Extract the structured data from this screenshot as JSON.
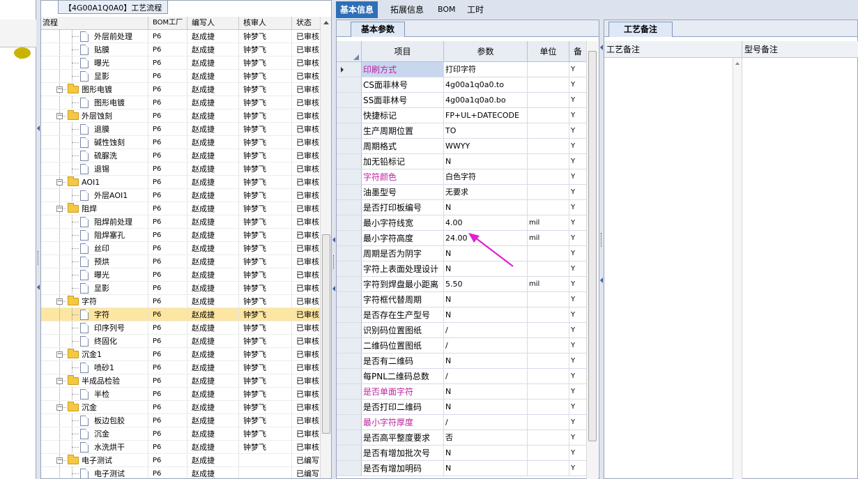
{
  "tree": {
    "title": "【4G00A1Q0A0】工艺流程",
    "columns": [
      "流程",
      "BOM工厂",
      "编写人",
      "核审人",
      "状态"
    ],
    "rows": [
      {
        "level": 2,
        "type": "doc",
        "name": "外层前处理",
        "bom": "P6",
        "writer": "赵成捷",
        "reviewer": "钟梦飞",
        "status": "已审核"
      },
      {
        "level": 2,
        "type": "doc",
        "name": "贴膜",
        "bom": "P6",
        "writer": "赵成捷",
        "reviewer": "钟梦飞",
        "status": "已审核"
      },
      {
        "level": 2,
        "type": "doc",
        "name": "曝光",
        "bom": "P6",
        "writer": "赵成捷",
        "reviewer": "钟梦飞",
        "status": "已审核"
      },
      {
        "level": 2,
        "type": "doc",
        "name": "显影",
        "bom": "P6",
        "writer": "赵成捷",
        "reviewer": "钟梦飞",
        "status": "已审核"
      },
      {
        "level": 1,
        "type": "folder",
        "name": "图形电镀",
        "bom": "P6",
        "writer": "赵成捷",
        "reviewer": "钟梦飞",
        "status": "已审核"
      },
      {
        "level": 2,
        "type": "doc",
        "name": "图形电镀",
        "bom": "P6",
        "writer": "赵成捷",
        "reviewer": "钟梦飞",
        "status": "已审核"
      },
      {
        "level": 1,
        "type": "folder",
        "name": "外层蚀刻",
        "bom": "P6",
        "writer": "赵成捷",
        "reviewer": "钟梦飞",
        "status": "已审核"
      },
      {
        "level": 2,
        "type": "doc",
        "name": "退膜",
        "bom": "P6",
        "writer": "赵成捷",
        "reviewer": "钟梦飞",
        "status": "已审核"
      },
      {
        "level": 2,
        "type": "doc",
        "name": "碱性蚀刻",
        "bom": "P6",
        "writer": "赵成捷",
        "reviewer": "钟梦飞",
        "status": "已审核"
      },
      {
        "level": 2,
        "type": "doc",
        "name": "硫脲洗",
        "bom": "P6",
        "writer": "赵成捷",
        "reviewer": "钟梦飞",
        "status": "已审核"
      },
      {
        "level": 2,
        "type": "doc",
        "name": "退锡",
        "bom": "P6",
        "writer": "赵成捷",
        "reviewer": "钟梦飞",
        "status": "已审核"
      },
      {
        "level": 1,
        "type": "folder",
        "name": "AOI1",
        "bom": "P6",
        "writer": "赵成捷",
        "reviewer": "钟梦飞",
        "status": "已审核"
      },
      {
        "level": 2,
        "type": "doc",
        "name": "外层AOI1",
        "bom": "P6",
        "writer": "赵成捷",
        "reviewer": "钟梦飞",
        "status": "已审核"
      },
      {
        "level": 1,
        "type": "folder",
        "name": "阻焊",
        "bom": "P6",
        "writer": "赵成捷",
        "reviewer": "钟梦飞",
        "status": "已审核"
      },
      {
        "level": 2,
        "type": "doc",
        "name": "阻焊前处理",
        "bom": "P6",
        "writer": "赵成捷",
        "reviewer": "钟梦飞",
        "status": "已审核"
      },
      {
        "level": 2,
        "type": "doc",
        "name": "阻焊塞孔",
        "bom": "P6",
        "writer": "赵成捷",
        "reviewer": "钟梦飞",
        "status": "已审核"
      },
      {
        "level": 2,
        "type": "doc",
        "name": "丝印",
        "bom": "P6",
        "writer": "赵成捷",
        "reviewer": "钟梦飞",
        "status": "已审核"
      },
      {
        "level": 2,
        "type": "doc",
        "name": "预烘",
        "bom": "P6",
        "writer": "赵成捷",
        "reviewer": "钟梦飞",
        "status": "已审核"
      },
      {
        "level": 2,
        "type": "doc",
        "name": "曝光",
        "bom": "P6",
        "writer": "赵成捷",
        "reviewer": "钟梦飞",
        "status": "已审核"
      },
      {
        "level": 2,
        "type": "doc",
        "name": "显影",
        "bom": "P6",
        "writer": "赵成捷",
        "reviewer": "钟梦飞",
        "status": "已审核"
      },
      {
        "level": 1,
        "type": "folder",
        "name": "字符",
        "bom": "P6",
        "writer": "赵成捷",
        "reviewer": "钟梦飞",
        "status": "已审核"
      },
      {
        "level": 2,
        "type": "doc",
        "name": "字符",
        "bom": "P6",
        "writer": "赵成捷",
        "reviewer": "钟梦飞",
        "status": "已审核",
        "selected": true
      },
      {
        "level": 2,
        "type": "doc",
        "name": "印序列号",
        "bom": "P6",
        "writer": "赵成捷",
        "reviewer": "钟梦飞",
        "status": "已审核"
      },
      {
        "level": 2,
        "type": "doc",
        "name": "终固化",
        "bom": "P6",
        "writer": "赵成捷",
        "reviewer": "钟梦飞",
        "status": "已审核"
      },
      {
        "level": 1,
        "type": "folder",
        "name": "沉金1",
        "bom": "P6",
        "writer": "赵成捷",
        "reviewer": "钟梦飞",
        "status": "已审核"
      },
      {
        "level": 2,
        "type": "doc",
        "name": "喷砂1",
        "bom": "P6",
        "writer": "赵成捷",
        "reviewer": "钟梦飞",
        "status": "已审核"
      },
      {
        "level": 1,
        "type": "folder",
        "name": "半成品检验",
        "bom": "P6",
        "writer": "赵成捷",
        "reviewer": "钟梦飞",
        "status": "已审核"
      },
      {
        "level": 2,
        "type": "doc",
        "name": "半检",
        "bom": "P6",
        "writer": "赵成捷",
        "reviewer": "钟梦飞",
        "status": "已审核"
      },
      {
        "level": 1,
        "type": "folder",
        "name": "沉金",
        "bom": "P6",
        "writer": "赵成捷",
        "reviewer": "钟梦飞",
        "status": "已审核"
      },
      {
        "level": 2,
        "type": "doc",
        "name": "板边包胶",
        "bom": "P6",
        "writer": "赵成捷",
        "reviewer": "钟梦飞",
        "status": "已审核"
      },
      {
        "level": 2,
        "type": "doc",
        "name": "沉金",
        "bom": "P6",
        "writer": "赵成捷",
        "reviewer": "钟梦飞",
        "status": "已审核"
      },
      {
        "level": 2,
        "type": "doc",
        "name": "水洗烘干",
        "bom": "P6",
        "writer": "赵成捷",
        "reviewer": "钟梦飞",
        "status": "已审核"
      },
      {
        "level": 1,
        "type": "folder",
        "name": "电子测试",
        "bom": "P6",
        "writer": "赵成捷",
        "reviewer": "",
        "status": "已编写"
      },
      {
        "level": 2,
        "type": "doc",
        "name": "电子测试",
        "bom": "P6",
        "writer": "赵成捷",
        "reviewer": "",
        "status": "已编写"
      }
    ]
  },
  "main_tabs": [
    "基本信息",
    "拓展信息",
    "BOM",
    "工时"
  ],
  "param": {
    "subtab": "基本参数",
    "columns": [
      "项目",
      "参数",
      "单位",
      "备"
    ],
    "rows": [
      {
        "item": "印刷方式",
        "value": "打印字符",
        "unit": "",
        "flag": "Y",
        "color": "magenta",
        "highlight": true,
        "current": true
      },
      {
        "item": "CS面菲林号",
        "value": "4g00a1q0a0.to",
        "unit": "",
        "flag": "Y"
      },
      {
        "item": "SS面菲林号",
        "value": "4g00a1q0a0.bo",
        "unit": "",
        "flag": "Y"
      },
      {
        "item": "快捷标记",
        "value": "FP+UL+DATECODE",
        "unit": "",
        "flag": "Y"
      },
      {
        "item": "生产周期位置",
        "value": "TO",
        "unit": "",
        "flag": "Y"
      },
      {
        "item": "周期格式",
        "value": "WWYY",
        "unit": "",
        "flag": "Y"
      },
      {
        "item": "加无铅标记",
        "value": "N",
        "unit": "",
        "flag": "Y"
      },
      {
        "item": "字符颜色",
        "value": "白色字符",
        "unit": "",
        "flag": "Y",
        "color": "magenta"
      },
      {
        "item": "油墨型号",
        "value": "无要求",
        "unit": "",
        "flag": "Y"
      },
      {
        "item": "是否打印板编号",
        "value": "N",
        "unit": "",
        "flag": "Y"
      },
      {
        "item": "最小字符线宽",
        "value": "4.00",
        "unit": "mil",
        "flag": "Y"
      },
      {
        "item": "最小字符高度",
        "value": "24.00",
        "unit": "mil",
        "flag": "Y"
      },
      {
        "item": "周期是否为阴字",
        "value": "N",
        "unit": "",
        "flag": "Y"
      },
      {
        "item": "字符上表面处理设计",
        "value": "N",
        "unit": "",
        "flag": "Y"
      },
      {
        "item": "字符到焊盘最小距离",
        "value": "5.50",
        "unit": "mil",
        "flag": "Y"
      },
      {
        "item": "字符框代替周期",
        "value": "N",
        "unit": "",
        "flag": "Y"
      },
      {
        "item": "是否存在生产型号",
        "value": "N",
        "unit": "",
        "flag": "Y"
      },
      {
        "item": "识别码位置图纸",
        "value": "/",
        "unit": "",
        "flag": "Y"
      },
      {
        "item": "二维码位置图纸",
        "value": "/",
        "unit": "",
        "flag": "Y"
      },
      {
        "item": "是否有二维码",
        "value": "N",
        "unit": "",
        "flag": "Y"
      },
      {
        "item": "每PNL二维码总数",
        "value": "/",
        "unit": "",
        "flag": "Y"
      },
      {
        "item": "是否单面字符",
        "value": "N",
        "unit": "",
        "flag": "Y",
        "color": "magenta"
      },
      {
        "item": "是否打印二维码",
        "value": "N",
        "unit": "",
        "flag": "Y"
      },
      {
        "item": "最小字符厚度",
        "value": "/",
        "unit": "",
        "flag": "Y",
        "color": "magenta"
      },
      {
        "item": "是否高平整度要求",
        "value": "否",
        "unit": "",
        "flag": "Y"
      },
      {
        "item": "是否有增加批次号",
        "value": "N",
        "unit": "",
        "flag": "Y"
      },
      {
        "item": "是否有增加明码",
        "value": "N",
        "unit": "",
        "flag": "Y"
      }
    ]
  },
  "notes": {
    "tab": "工艺备注",
    "columns": [
      "工艺备注",
      "型号备注"
    ]
  },
  "colors": {
    "accent": "#2f6fb7",
    "selection": "#fce6a2",
    "magenta_label": "#c020a0",
    "annotation": "#e020d0"
  }
}
